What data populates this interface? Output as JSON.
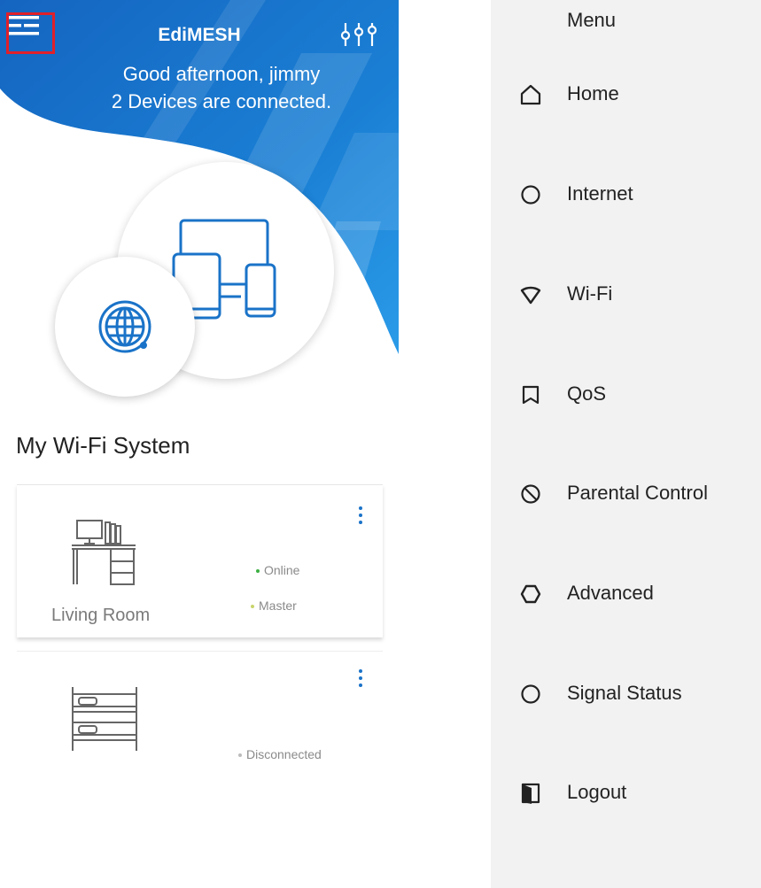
{
  "header": {
    "app_title": "EdiMESH",
    "greeting": "Good afternoon, jimmy",
    "devices_status": "2 Devices are connected."
  },
  "colors": {
    "brand_blue": "#1a73c8",
    "highlight_red": "#e0202a",
    "online_green": "#3cb043",
    "master_yellow": "#c9d46a"
  },
  "icons": {
    "menu": "hamburger-icon",
    "settings": "sliders-icon",
    "internet": "globe-icon",
    "devices": "devices-icon"
  },
  "wifi_system": {
    "title": "My Wi-Fi System",
    "nodes": [
      {
        "name": "Living Room",
        "statuses": [
          "Online",
          "Master"
        ],
        "icon": "desk-icon"
      },
      {
        "name": "",
        "statuses": [
          "Disconnected"
        ],
        "icon": "bunk-bed-icon"
      }
    ]
  },
  "drawer": {
    "title": "Menu",
    "items": [
      {
        "label": "Home",
        "icon": "home-icon"
      },
      {
        "label": "Internet",
        "icon": "circle-icon"
      },
      {
        "label": "Wi-Fi",
        "icon": "wifi-shield-icon"
      },
      {
        "label": "QoS",
        "icon": "bookmark-icon"
      },
      {
        "label": "Parental Control",
        "icon": "block-icon"
      },
      {
        "label": "Advanced",
        "icon": "hexagon-icon"
      },
      {
        "label": "Signal Status",
        "icon": "circle-icon"
      },
      {
        "label": "Logout",
        "icon": "door-icon"
      }
    ]
  }
}
